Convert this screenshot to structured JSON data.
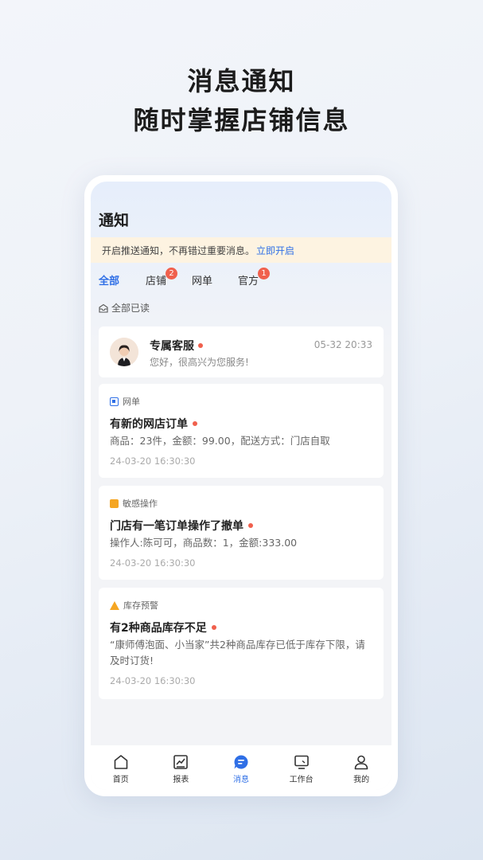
{
  "headline": {
    "line1": "消息通知",
    "line2": "随时掌握店铺信息"
  },
  "page": {
    "title": "通知"
  },
  "push_banner": {
    "text": "开启推送通知，不再错过重要消息。",
    "action": "立即开启"
  },
  "tabs": [
    {
      "label": "全部",
      "active": true
    },
    {
      "label": "店铺",
      "badge": "2"
    },
    {
      "label": "网单"
    },
    {
      "label": "官方",
      "badge": "1"
    }
  ],
  "mark_all_read": "全部已读",
  "customer_service": {
    "name": "专属客服",
    "message": "您好，很高兴为您服务!",
    "time": "05-32 20:33"
  },
  "notifications": [
    {
      "category": "网单",
      "title": "有新的网店订单",
      "body": "商品：23件，金额：99.00，配送方式：门店自取",
      "time": "24-03-20 16:30:30"
    },
    {
      "category": "敏感操作",
      "title": "门店有一笔订单操作了撤单",
      "body": "操作人:陈可可，商品数：1，金额:333.00",
      "time": "24-03-20 16:30:30"
    },
    {
      "category": "库存预警",
      "title": "有2种商品库存不足",
      "body": "“康师傅泡面、小当家”共2种商品库存已低于库存下限，请及时订货!",
      "time": "24-03-20 16:30:30"
    }
  ],
  "tabbar": [
    {
      "label": "首页",
      "icon": "home-icon"
    },
    {
      "label": "报表",
      "icon": "report-icon"
    },
    {
      "label": "消息",
      "icon": "message-icon",
      "active": true
    },
    {
      "label": "工作台",
      "icon": "workbench-icon"
    },
    {
      "label": "我的",
      "icon": "profile-icon"
    }
  ],
  "colors": {
    "accent": "#2f6fe6",
    "badge": "#f0604d",
    "banner_bg": "#fdf3e1"
  }
}
